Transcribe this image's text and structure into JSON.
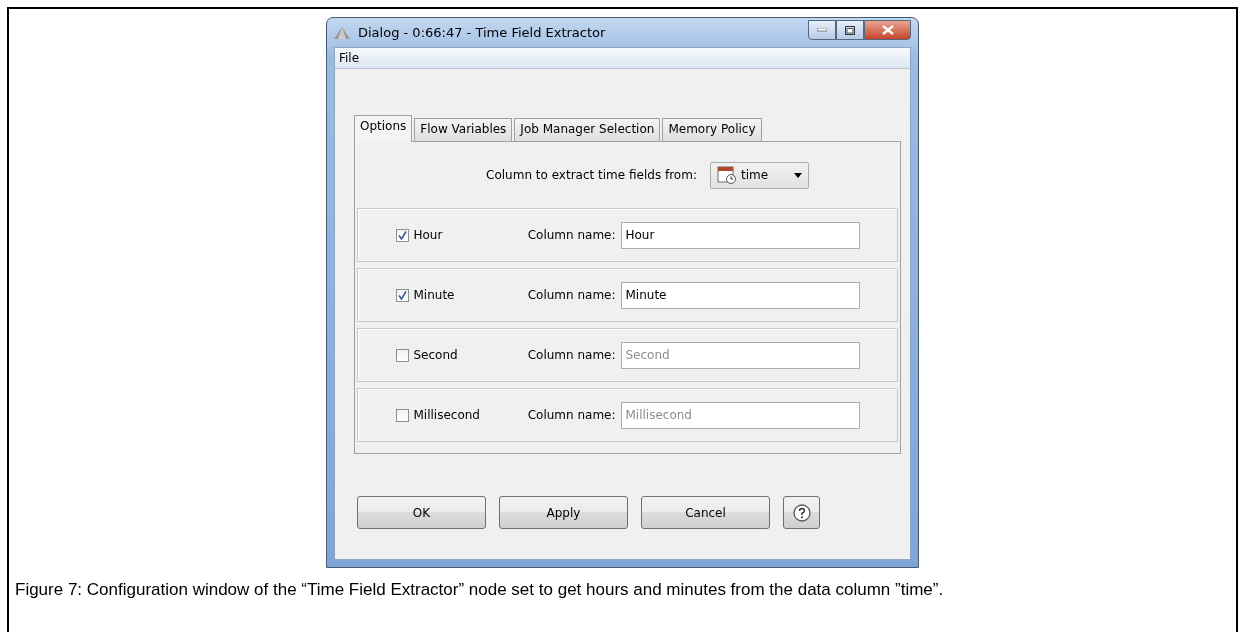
{
  "window": {
    "title": "Dialog - 0:66:47 - Time Field Extractor"
  },
  "menu": [
    "File"
  ],
  "tabs": [
    {
      "label": "Options",
      "selected": true
    },
    {
      "label": "Flow Variables",
      "selected": false
    },
    {
      "label": "Job Manager Selection",
      "selected": false
    },
    {
      "label": "Memory Policy",
      "selected": false
    }
  ],
  "column_selector": {
    "label": "Column to extract time fields from:",
    "value": "time"
  },
  "fields": [
    {
      "label": "Hour",
      "checked": true,
      "column_label": "Column name:",
      "value": "Hour"
    },
    {
      "label": "Minute",
      "checked": true,
      "column_label": "Column name:",
      "value": "Minute"
    },
    {
      "label": "Second",
      "checked": false,
      "column_label": "Column name:",
      "value": "Second"
    },
    {
      "label": "Millisecond",
      "checked": false,
      "column_label": "Column name:",
      "value": "Millisecond"
    }
  ],
  "buttons": [
    "OK",
    "Apply",
    "Cancel"
  ],
  "caption": "Figure 7: Configuration window of the “Time Field Extractor” node set to get hours and minutes from the data column ”time”."
}
